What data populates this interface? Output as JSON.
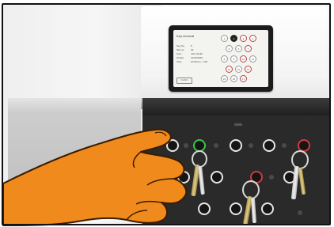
{
  "screen": {
    "title": "Key removal",
    "info": [
      {
        "label": "Key No.",
        "value": "5"
      },
      {
        "label": "Slot no.",
        "value": "40"
      },
      {
        "label": "User",
        "value": "John Smith"
      },
      {
        "label": "Output",
        "value": "12/04/2019"
      },
      {
        "label": "Time",
        "value": "10:08 am - 1:00"
      }
    ],
    "footer_label": "Confirm",
    "slots": [
      "1",
      "2",
      "3",
      "4",
      "5",
      "6",
      "7",
      "8",
      "9",
      "10",
      "11",
      "12",
      "13",
      "14",
      "15",
      "16",
      "17"
    ]
  },
  "colors": {
    "green_led": "#3cc44a",
    "red_led": "#d23a3a",
    "hand_fill": "#f08a1c",
    "hand_stroke": "#3a1c00"
  },
  "icons": {
    "hand": "pointing-hand-icon"
  }
}
